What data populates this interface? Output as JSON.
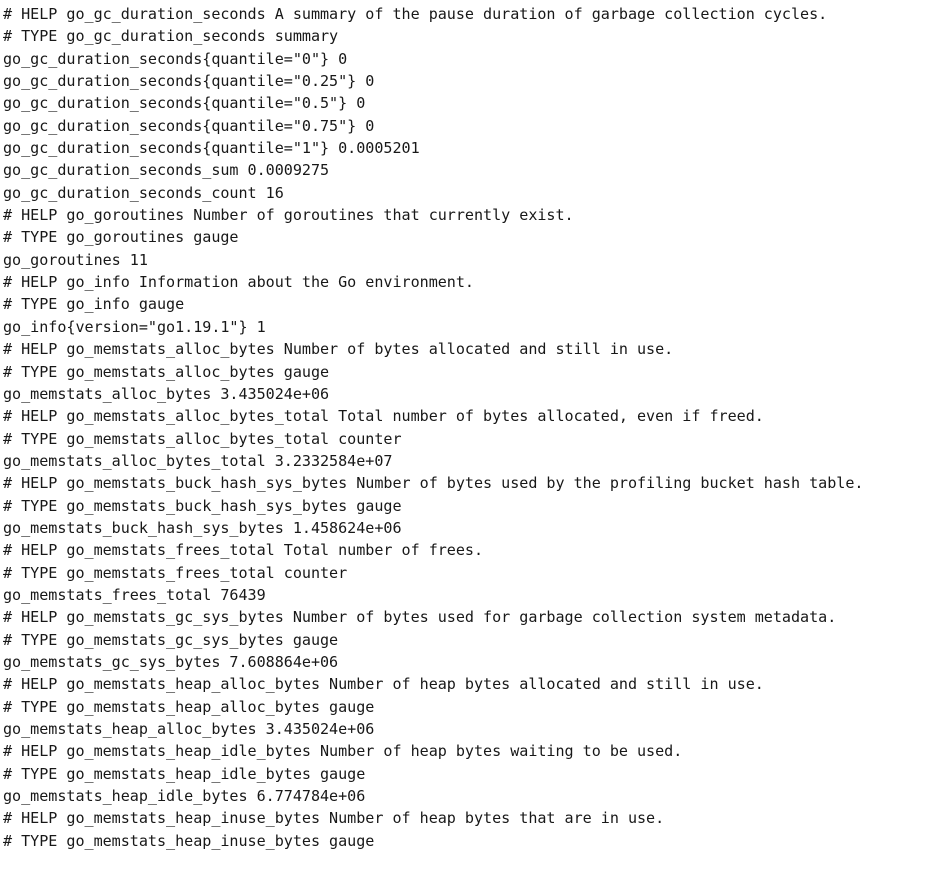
{
  "page": {
    "kind": "prometheus-metrics-plaintext",
    "background_color": "#ffffff",
    "text_color": "#181818"
  },
  "metrics_text": {
    "lines": [
      "# HELP go_gc_duration_seconds A summary of the pause duration of garbage collection cycles.",
      "# TYPE go_gc_duration_seconds summary",
      "go_gc_duration_seconds{quantile=\"0\"} 0",
      "go_gc_duration_seconds{quantile=\"0.25\"} 0",
      "go_gc_duration_seconds{quantile=\"0.5\"} 0",
      "go_gc_duration_seconds{quantile=\"0.75\"} 0",
      "go_gc_duration_seconds{quantile=\"1\"} 0.0005201",
      "go_gc_duration_seconds_sum 0.0009275",
      "go_gc_duration_seconds_count 16",
      "# HELP go_goroutines Number of goroutines that currently exist.",
      "# TYPE go_goroutines gauge",
      "go_goroutines 11",
      "# HELP go_info Information about the Go environment.",
      "# TYPE go_info gauge",
      "go_info{version=\"go1.19.1\"} 1",
      "# HELP go_memstats_alloc_bytes Number of bytes allocated and still in use.",
      "# TYPE go_memstats_alloc_bytes gauge",
      "go_memstats_alloc_bytes 3.435024e+06",
      "# HELP go_memstats_alloc_bytes_total Total number of bytes allocated, even if freed.",
      "# TYPE go_memstats_alloc_bytes_total counter",
      "go_memstats_alloc_bytes_total 3.2332584e+07",
      "# HELP go_memstats_buck_hash_sys_bytes Number of bytes used by the profiling bucket hash table.",
      "# TYPE go_memstats_buck_hash_sys_bytes gauge",
      "go_memstats_buck_hash_sys_bytes 1.458624e+06",
      "# HELP go_memstats_frees_total Total number of frees.",
      "# TYPE go_memstats_frees_total counter",
      "go_memstats_frees_total 76439",
      "# HELP go_memstats_gc_sys_bytes Number of bytes used for garbage collection system metadata.",
      "# TYPE go_memstats_gc_sys_bytes gauge",
      "go_memstats_gc_sys_bytes 7.608864e+06",
      "# HELP go_memstats_heap_alloc_bytes Number of heap bytes allocated and still in use.",
      "# TYPE go_memstats_heap_alloc_bytes gauge",
      "go_memstats_heap_alloc_bytes 3.435024e+06",
      "# HELP go_memstats_heap_idle_bytes Number of heap bytes waiting to be used.",
      "# TYPE go_memstats_heap_idle_bytes gauge",
      "go_memstats_heap_idle_bytes 6.774784e+06",
      "# HELP go_memstats_heap_inuse_bytes Number of heap bytes that are in use.",
      "# TYPE go_memstats_heap_inuse_bytes gauge"
    ]
  },
  "metrics_parsed": [
    {
      "name": "go_gc_duration_seconds",
      "help": "A summary of the pause duration of garbage collection cycles.",
      "type": "summary",
      "samples": [
        {
          "labels": {
            "quantile": "0"
          },
          "value": "0"
        },
        {
          "labels": {
            "quantile": "0.25"
          },
          "value": "0"
        },
        {
          "labels": {
            "quantile": "0.5"
          },
          "value": "0"
        },
        {
          "labels": {
            "quantile": "0.75"
          },
          "value": "0"
        },
        {
          "labels": {
            "quantile": "1"
          },
          "value": "0.0005201"
        },
        {
          "name": "go_gc_duration_seconds_sum",
          "value": "0.0009275"
        },
        {
          "name": "go_gc_duration_seconds_count",
          "value": "16"
        }
      ]
    },
    {
      "name": "go_goroutines",
      "help": "Number of goroutines that currently exist.",
      "type": "gauge",
      "samples": [
        {
          "value": "11"
        }
      ]
    },
    {
      "name": "go_info",
      "help": "Information about the Go environment.",
      "type": "gauge",
      "samples": [
        {
          "labels": {
            "version": "go1.19.1"
          },
          "value": "1"
        }
      ]
    },
    {
      "name": "go_memstats_alloc_bytes",
      "help": "Number of bytes allocated and still in use.",
      "type": "gauge",
      "samples": [
        {
          "value": "3.435024e+06"
        }
      ]
    },
    {
      "name": "go_memstats_alloc_bytes_total",
      "help": "Total number of bytes allocated, even if freed.",
      "type": "counter",
      "samples": [
        {
          "value": "3.2332584e+07"
        }
      ]
    },
    {
      "name": "go_memstats_buck_hash_sys_bytes",
      "help": "Number of bytes used by the profiling bucket hash table.",
      "type": "gauge",
      "samples": [
        {
          "value": "1.458624e+06"
        }
      ]
    },
    {
      "name": "go_memstats_frees_total",
      "help": "Total number of frees.",
      "type": "counter",
      "samples": [
        {
          "value": "76439"
        }
      ]
    },
    {
      "name": "go_memstats_gc_sys_bytes",
      "help": "Number of bytes used for garbage collection system metadata.",
      "type": "gauge",
      "samples": [
        {
          "value": "7.608864e+06"
        }
      ]
    },
    {
      "name": "go_memstats_heap_alloc_bytes",
      "help": "Number of heap bytes allocated and still in use.",
      "type": "gauge",
      "samples": [
        {
          "value": "3.435024e+06"
        }
      ]
    },
    {
      "name": "go_memstats_heap_idle_bytes",
      "help": "Number of heap bytes waiting to be used.",
      "type": "gauge",
      "samples": [
        {
          "value": "6.774784e+06"
        }
      ]
    },
    {
      "name": "go_memstats_heap_inuse_bytes",
      "help": "Number of heap bytes that are in use.",
      "type": "gauge",
      "samples": []
    }
  ]
}
